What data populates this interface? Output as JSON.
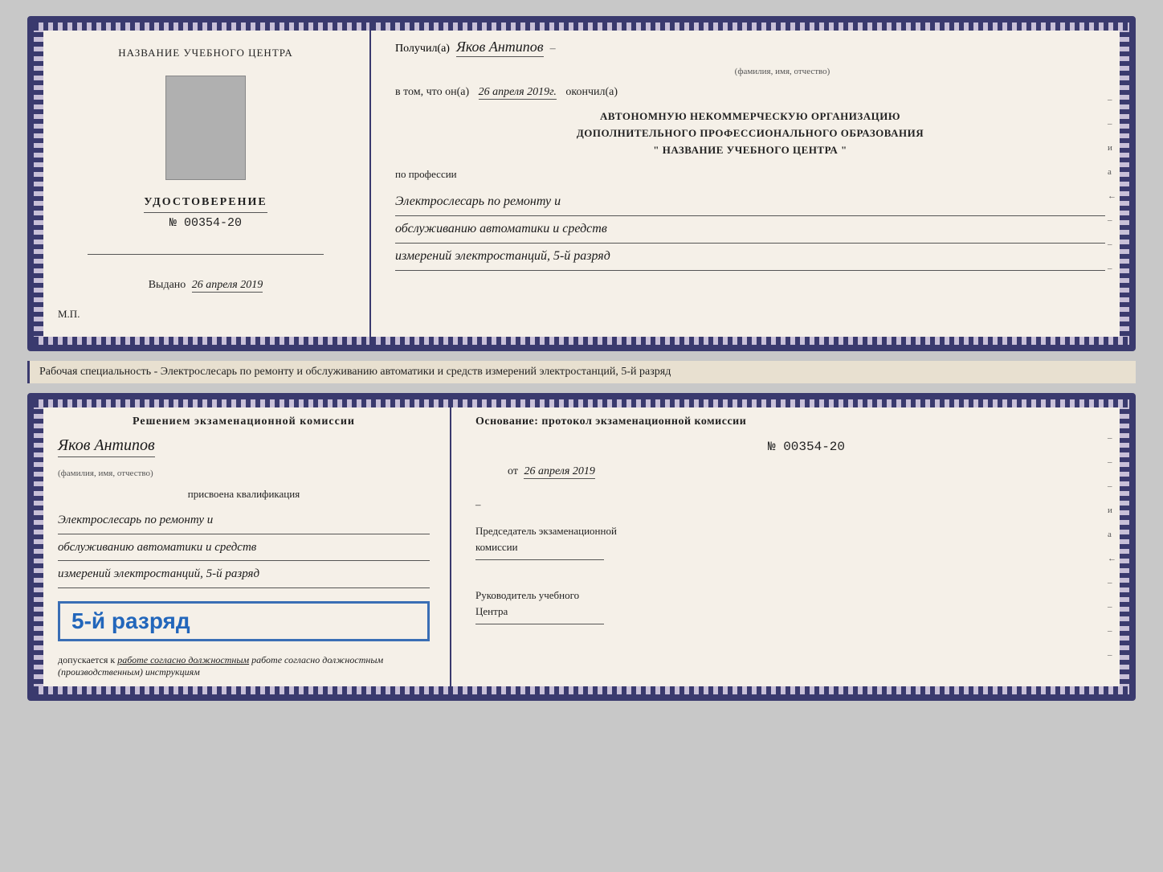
{
  "doc1": {
    "left": {
      "centerTitle": "НАЗВАНИЕ УЧЕБНОГО ЦЕНТРА",
      "certLabel": "УДОСТОВЕРЕНИЕ",
      "certNumber": "№ 00354-20",
      "issuedLabel": "Выдано",
      "issuedDate": "26 апреля 2019",
      "mpLabel": "М.П."
    },
    "right": {
      "receivedLabel": "Получил(а)",
      "recipientName": "Яков Антипов",
      "recipientSubtitle": "(фамилия, имя, отчество)",
      "dateIntroLabel": "в том, что он(а)",
      "completionDate": "26 апреля 2019г.",
      "completionLabel": "окончил(а)",
      "orgLine1": "АВТОНОМНУЮ НЕКОММЕРЧЕСКУЮ ОРГАНИЗАЦИЮ",
      "orgLine2": "ДОПОЛНИТЕЛЬНОГО ПРОФЕССИОНАЛЬНОГО ОБРАЗОВАНИЯ",
      "orgLine3": "\"  НАЗВАНИЕ УЧЕБНОГО ЦЕНТРА  \"",
      "professionLabel": "по профессии",
      "professionLine1": "Электрослесарь по ремонту и",
      "professionLine2": "обслуживанию автоматики и средств",
      "professionLine3": "измерений электростанций, 5-й разряд"
    }
  },
  "descriptionBar": {
    "text": "Рабочая специальность - Электрослесарь по ремонту и обслуживанию автоматики и средств измерений электростанций, 5-й разряд"
  },
  "doc2": {
    "left": {
      "resolutionTitle": "Решением экзаменационной комиссии",
      "personName": "Яков Антипов",
      "personSubtitle": "(фамилия, имя, отчество)",
      "qualificationLabel": "присвоена квалификация",
      "qualificationLine1": "Электрослесарь по ремонту и",
      "qualificationLine2": "обслуживанию автоматики и средств",
      "qualificationLine3": "измерений электростанций, 5-й разряд",
      "gradeText": "5-й разряд",
      "допускLabel": "допускается к",
      "допускText": "работе согласно должностным",
      "допускText2": "(производственным) инструкциям"
    },
    "right": {
      "basisLabel": "Основание: протокол экзаменационной комиссии",
      "basisNumber": "№ 00354-20",
      "basisDateLabel": "от",
      "basisDate": "26 апреля 2019",
      "chairLabel": "Председатель экзаменационной",
      "chairLabel2": "комиссии",
      "centerHeadLabel": "Руководитель учебного",
      "centerHeadLabel2": "Центра"
    }
  }
}
